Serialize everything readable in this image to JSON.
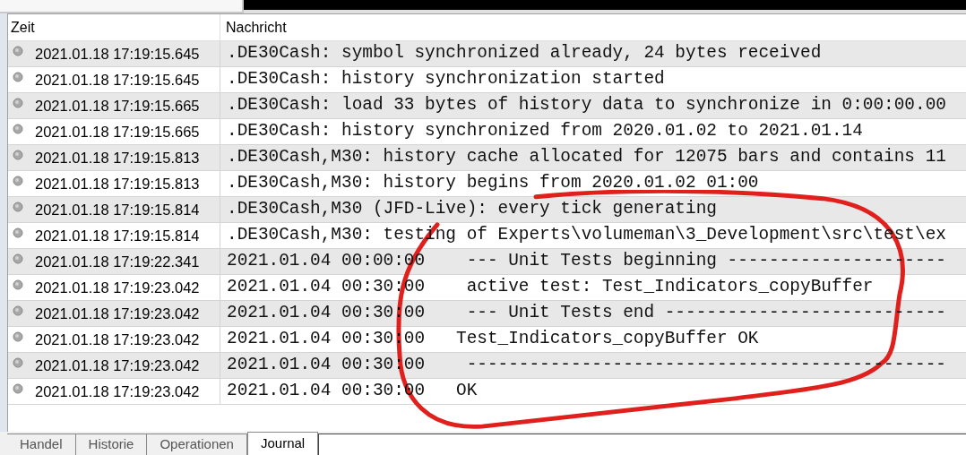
{
  "table": {
    "columns": [
      "Zeit",
      "Nachricht"
    ],
    "rows": [
      {
        "time": "2021.01.18 17:19:15.645",
        "message": ".DE30Cash: symbol synchronized already, 24 bytes received"
      },
      {
        "time": "2021.01.18 17:19:15.645",
        "message": ".DE30Cash: history synchronization started"
      },
      {
        "time": "2021.01.18 17:19:15.665",
        "message": ".DE30Cash: load 33 bytes of history data to synchronize in 0:00:00.00"
      },
      {
        "time": "2021.01.18 17:19:15.665",
        "message": ".DE30Cash: history synchronized from 2020.01.02 to 2021.01.14"
      },
      {
        "time": "2021.01.18 17:19:15.813",
        "message": ".DE30Cash,M30: history cache allocated for 12075 bars and contains 11"
      },
      {
        "time": "2021.01.18 17:19:15.813",
        "message": ".DE30Cash,M30: history begins from 2020.01.02 01:00"
      },
      {
        "time": "2021.01.18 17:19:15.814",
        "message": ".DE30Cash,M30 (JFD-Live): every tick generating"
      },
      {
        "time": "2021.01.18 17:19:15.814",
        "message": ".DE30Cash,M30: testing of Experts\\volumeman\\3_Development\\src\\test\\ex"
      },
      {
        "time": "2021.01.18 17:19:22.341",
        "message": "2021.01.04 00:00:00    --- Unit Tests beginning ---------------------"
      },
      {
        "time": "2021.01.18 17:19:23.042",
        "message": "2021.01.04 00:30:00    active test: Test_Indicators_copyBuffer"
      },
      {
        "time": "2021.01.18 17:19:23.042",
        "message": "2021.01.04 00:30:00    --- Unit Tests end ---------------------------"
      },
      {
        "time": "2021.01.18 17:19:23.042",
        "message": "2021.01.04 00:30:00   Test_Indicators_copyBuffer OK"
      },
      {
        "time": "2021.01.18 17:19:23.042",
        "message": "2021.01.04 00:30:00    ----------------------------------------------"
      },
      {
        "time": "2021.01.18 17:19:23.042",
        "message": "2021.01.04 00:30:00   OK"
      }
    ]
  },
  "tabs": [
    {
      "label": "Handel",
      "selected": false
    },
    {
      "label": "Historie",
      "selected": false
    },
    {
      "label": "Operationen",
      "selected": false
    },
    {
      "label": "Journal",
      "selected": true
    }
  ]
}
